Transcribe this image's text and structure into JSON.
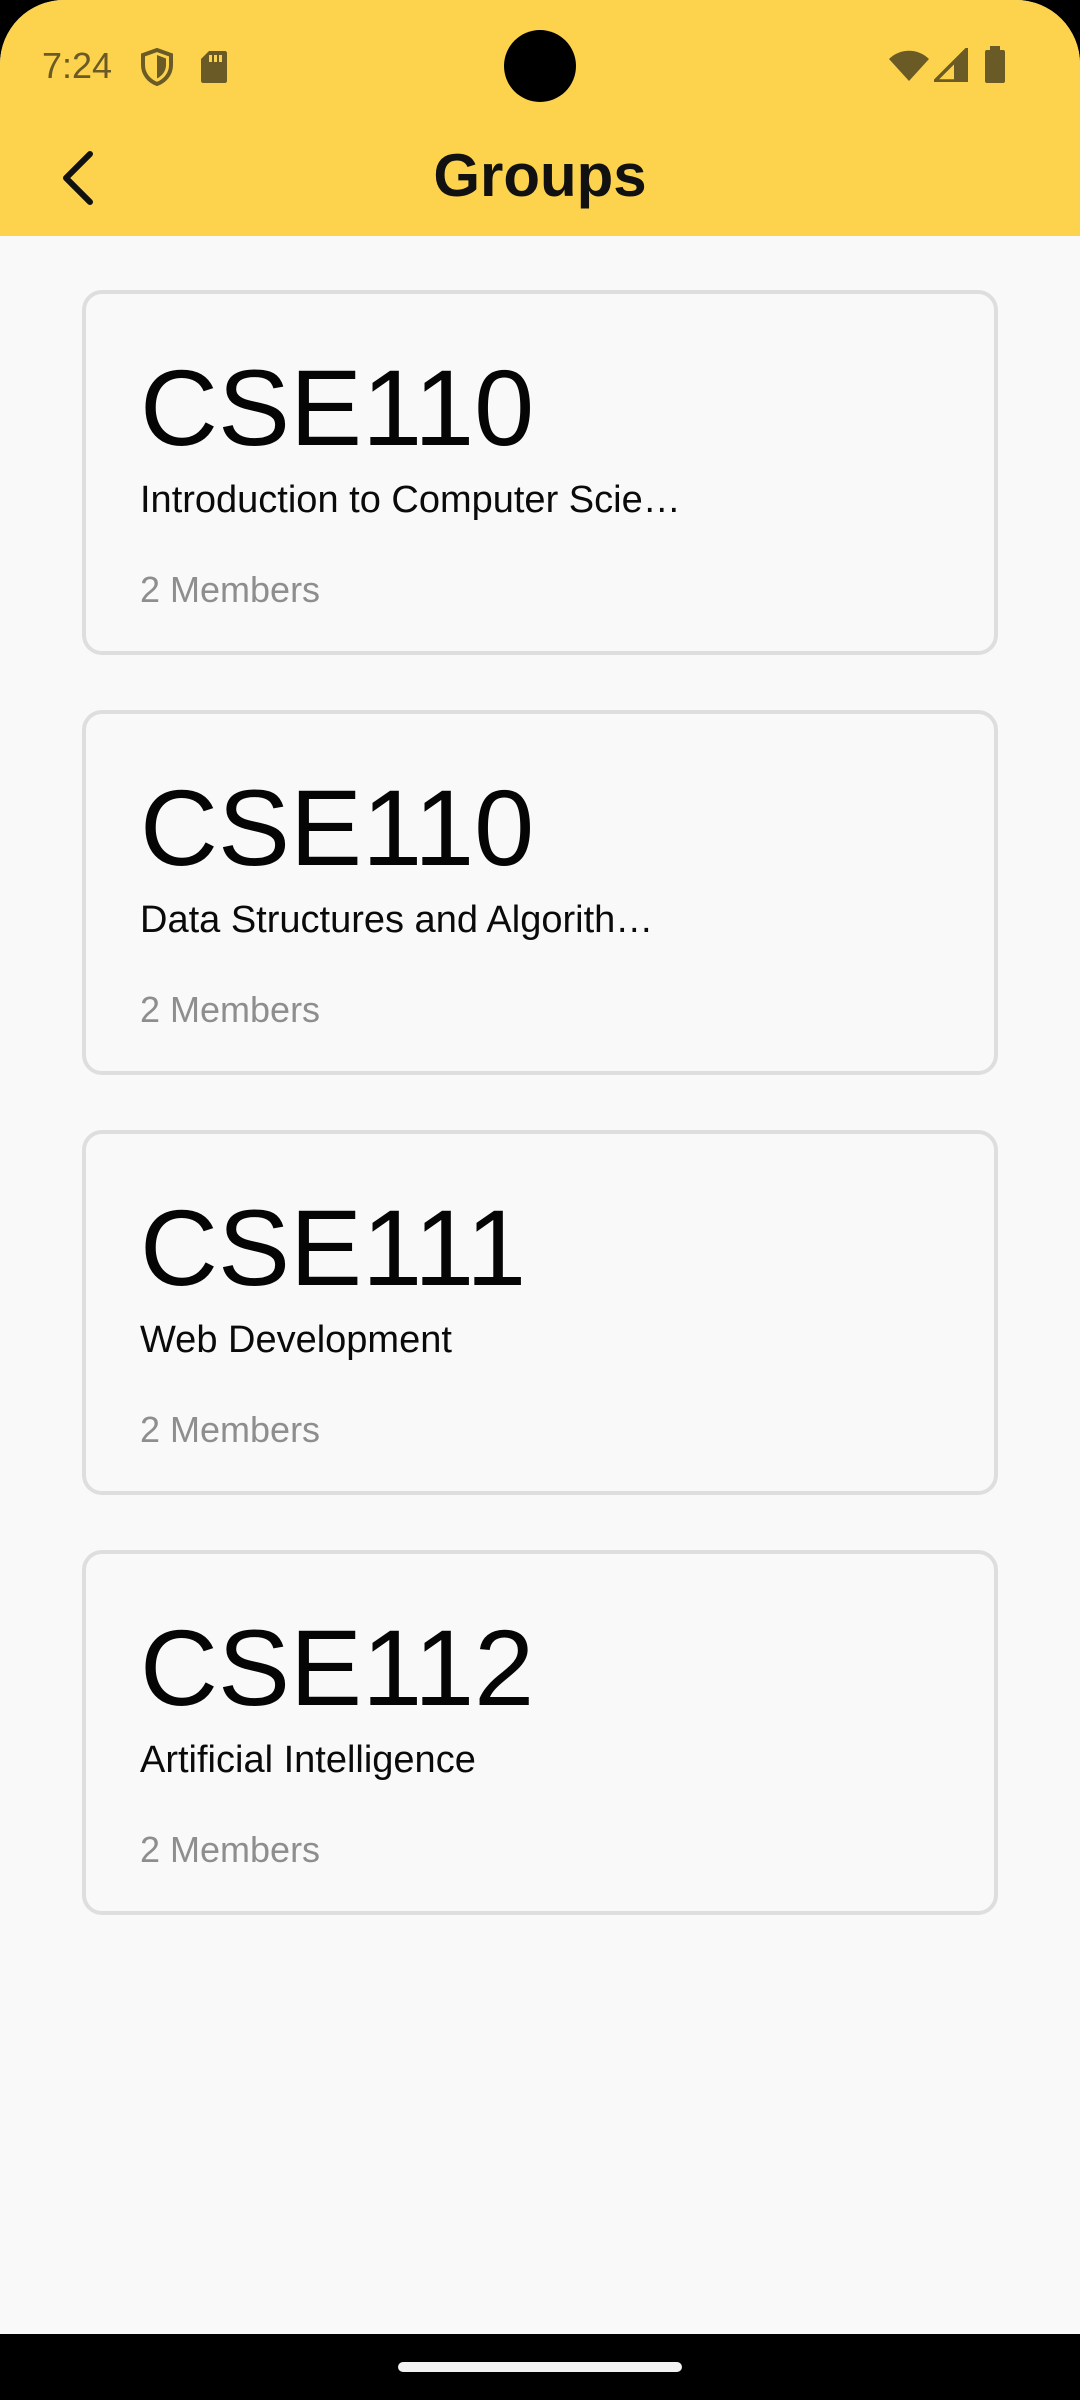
{
  "status_bar": {
    "time": "7:24",
    "icons": [
      "shield-icon",
      "sd-card-icon",
      "wifi-icon",
      "cell-signal-icon",
      "battery-icon"
    ]
  },
  "header": {
    "title": "Groups",
    "back_icon": "chevron-left-icon"
  },
  "groups": [
    {
      "code": "CSE110",
      "name": "Introduction to Computer Scie…",
      "members": "2 Members"
    },
    {
      "code": "CSE110",
      "name": "Data Structures and Algorith…",
      "members": "2 Members"
    },
    {
      "code": "CSE111",
      "name": "Web Development",
      "members": "2 Members"
    },
    {
      "code": "CSE112",
      "name": "Artificial Intelligence",
      "members": "2 Members"
    }
  ],
  "colors": {
    "app_bar": "#fdd34d",
    "background": "#f9f9f9",
    "card_border": "#dedede",
    "muted_text": "#8e8e8e"
  }
}
